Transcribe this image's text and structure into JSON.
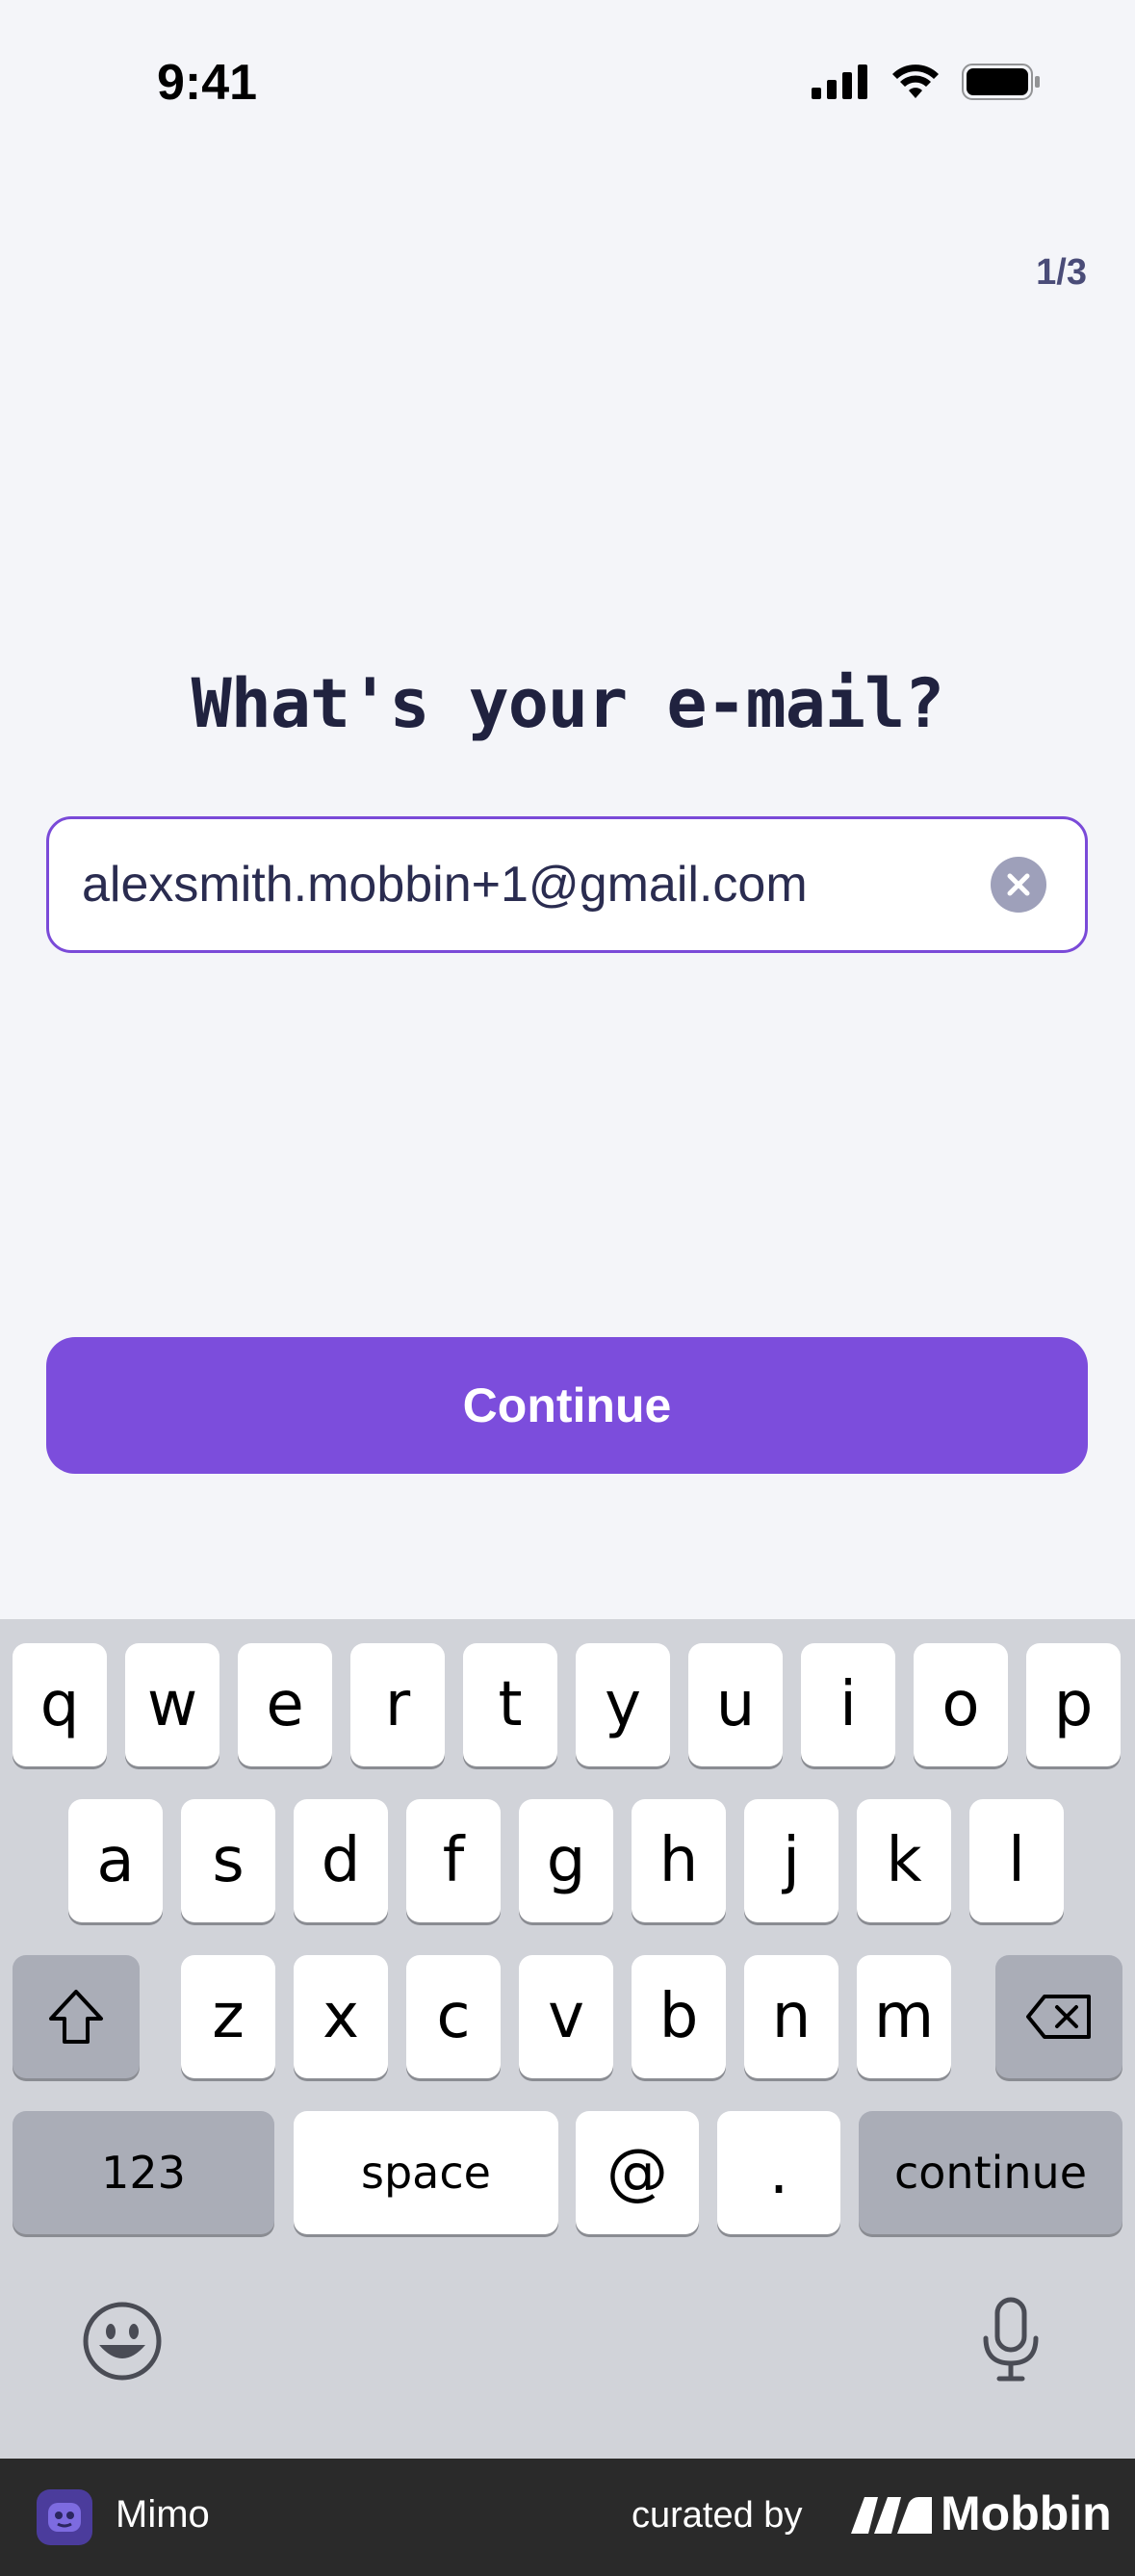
{
  "status_bar": {
    "time": "9:41"
  },
  "header": {
    "step": "1/3"
  },
  "main": {
    "title": "What's your e-mail?",
    "email_value": "alexsmith.mobbin+1@gmail.com",
    "continue_label": "Continue",
    "accent_color": "#7c4ddc"
  },
  "keyboard": {
    "row1": [
      "q",
      "w",
      "e",
      "r",
      "t",
      "y",
      "u",
      "i",
      "o",
      "p"
    ],
    "row2": [
      "a",
      "s",
      "d",
      "f",
      "g",
      "h",
      "j",
      "k",
      "l"
    ],
    "row3": [
      "z",
      "x",
      "c",
      "v",
      "b",
      "n",
      "m"
    ],
    "numbers_label": "123",
    "space_label": "space",
    "at_label": "@",
    "dot_label": ".",
    "continue_label": "continue"
  },
  "footer": {
    "app_name": "Mimo",
    "curated_by": "curated by",
    "brand": "Mobbin"
  }
}
